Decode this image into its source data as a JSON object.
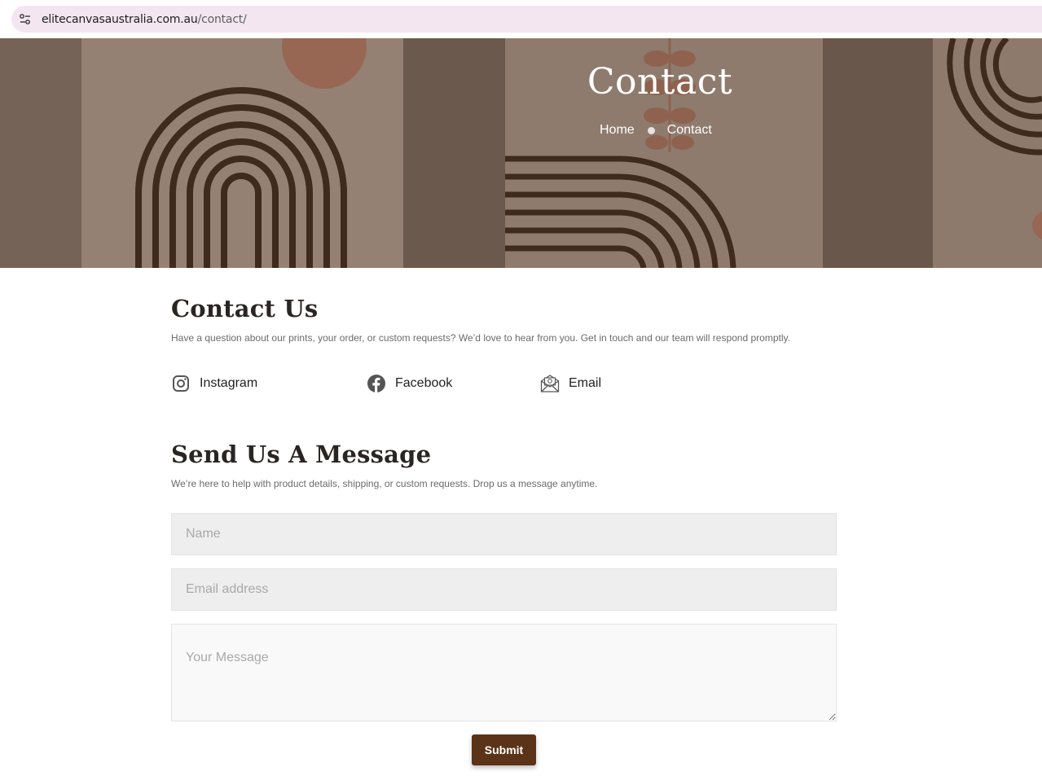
{
  "browser": {
    "site_info_icon": "tune-icon",
    "url_domain": "elitecanvasaustralia.com.au",
    "url_path": "/contact/"
  },
  "hero": {
    "title": "Contact",
    "breadcrumb": {
      "home": "Home",
      "current": "Contact"
    }
  },
  "contact": {
    "title": "Contact Us",
    "description": "Have a question about our prints, your order, or custom requests? We’d love to hear from you. Get in touch and our team will respond promptly.",
    "links": [
      {
        "label": "Instagram",
        "icon": "instagram-icon"
      },
      {
        "label": "Facebook",
        "icon": "facebook-icon"
      },
      {
        "label": "Email",
        "icon": "email-envelope-icon"
      }
    ]
  },
  "form": {
    "title": "Send Us A Message",
    "description": "We’re here to help with product details, shipping, or custom requests. Drop us a message anytime.",
    "name_placeholder": "Name",
    "email_placeholder": "Email address",
    "message_placeholder": "Your Message",
    "submit_label": "Submit"
  },
  "colors": {
    "accent": "#5a3318",
    "hero_bg": "#8e7b6d",
    "address_bar": "#f3e6f1"
  }
}
